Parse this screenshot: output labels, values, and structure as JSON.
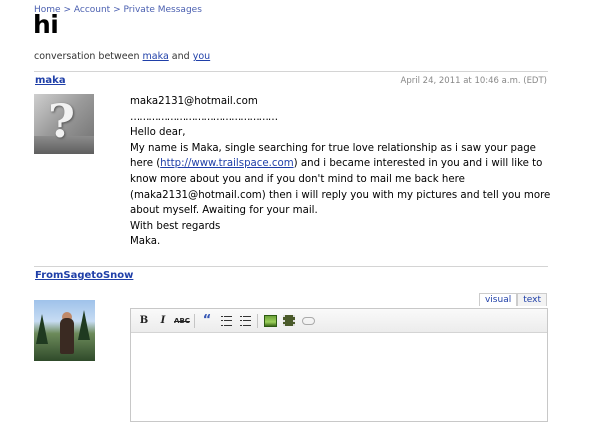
{
  "breadcrumb": {
    "home": "Home",
    "sep1": ">",
    "account": "Account",
    "sep2": ">",
    "pm": "Private Messages"
  },
  "page_title": "hi",
  "conversation": {
    "prefix": "conversation between",
    "user1": "maka",
    "joiner": "and",
    "user2": "you"
  },
  "message": {
    "author": "maka",
    "timestamp": "April 24, 2011 at 10:46 a.m. (EDT)",
    "email_line": "maka2131@hotmail.com",
    "dots": "…………………………………………",
    "greeting": "Hello dear,",
    "body1": "My name is Maka, single searching for true love relationship as i saw your page",
    "body2_pre": "here  (",
    "link": "http://www.trailspace.com",
    "body2_post": ") and i became interested in you and i will like to",
    "body3": "know more about you and if you don't mind to mail me back here",
    "body4": "(maka2131@hotmail.com) then i will reply you with my pictures and tell you more",
    "body5": "about myself. Awaiting for your mail.",
    "signoff": "With best regards",
    "sign": "Maka."
  },
  "reply": {
    "author": "FromSagetoSnow",
    "tab_visual": "visual",
    "tab_text": "text",
    "toolbar": {
      "bold": "B",
      "italic": "I",
      "strike": "ABC",
      "quote": "“",
      "value": ""
    }
  }
}
